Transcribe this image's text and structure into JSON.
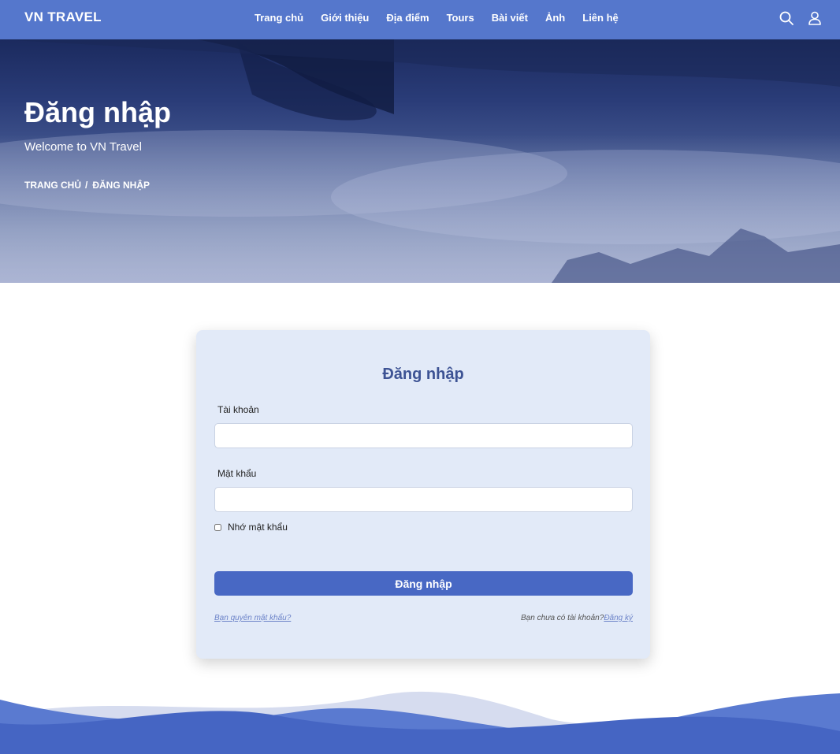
{
  "navbar": {
    "brand": "VN TRAVEL",
    "links": [
      "Trang chủ",
      "Giới thiệu",
      "Địa điểm",
      "Tours",
      "Bài viết",
      "Ảnh",
      "Liên hệ"
    ],
    "icons": [
      "search-icon",
      "user-icon"
    ]
  },
  "hero": {
    "title": "Đăng nhập",
    "subtitle": "Welcome to VN Travel",
    "breadcrumb": {
      "home": "TRANG CHỦ",
      "separator": "/",
      "current": "ĐĂNG NHẬP"
    }
  },
  "login": {
    "title": "Đăng nhập",
    "username_label": "Tài khoản",
    "username_value": "",
    "password_label": "Mật khẩu",
    "password_value": "",
    "remember_label": "Nhớ mật khẩu",
    "remember_checked": false,
    "submit_label": "Đăng nhập",
    "forgot_link": "Bạn quyên mật khẩu?",
    "no_account_text": "Bạn chưa có tài khoản?",
    "signup_link": "Đăng ký"
  },
  "colors": {
    "navbar": "#5577cc",
    "card_bg": "#e2eaf8",
    "title": "#3d5394",
    "button": "#4868c4",
    "link": "#6d84c9",
    "wave_dark": "#4565c3",
    "wave_mid": "#5a7ad0",
    "wave_light": "#d6dcef"
  }
}
